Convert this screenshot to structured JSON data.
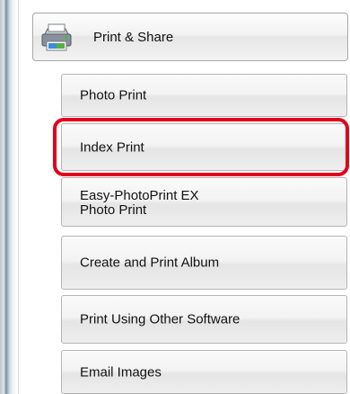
{
  "header": {
    "label": "Print & Share",
    "icon": "printer-icon"
  },
  "items": [
    {
      "label": "Photo Print"
    },
    {
      "label": "Index Print",
      "highlighted": true
    },
    {
      "label_line1": "Easy-PhotoPrint EX",
      "label_line2": "Photo Print"
    },
    {
      "label": "Create and Print Album"
    },
    {
      "label": "Print Using Other Software"
    },
    {
      "label": "Email Images"
    }
  ],
  "colors": {
    "highlight": "#e3001a",
    "button_border": "#b4b4b4",
    "text": "#111111"
  }
}
